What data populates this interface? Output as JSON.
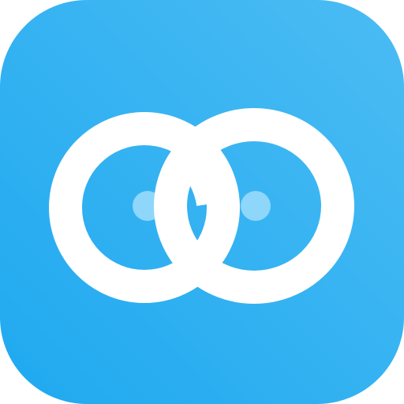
{
  "icon": {
    "name": "interlocking-rings-app-icon",
    "colors": {
      "background_light": "#4bbcf3",
      "background_dark": "#1fa9f0",
      "ring": "#ffffff",
      "dot": "#8fd6fb"
    }
  }
}
